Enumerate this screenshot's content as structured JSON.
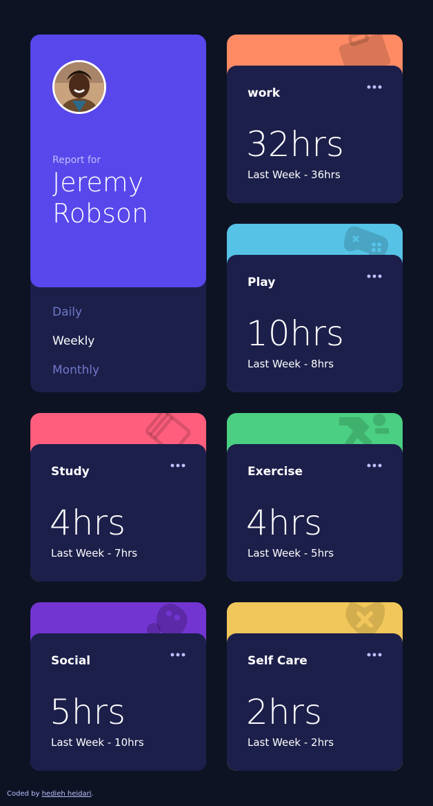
{
  "profile": {
    "report_for": "Report for",
    "first_name": "Jeremy",
    "last_name": "Robson",
    "periods": [
      "Daily",
      "Weekly",
      "Monthly"
    ],
    "active_period": "Weekly"
  },
  "cards": [
    {
      "title": "work",
      "hours": "32hrs",
      "previous": "Last Week - 36hrs",
      "color": "#ff8b64",
      "icon": "briefcase-icon"
    },
    {
      "title": "Play",
      "hours": "10hrs",
      "previous": "Last Week - 8hrs",
      "color": "#56c2e6",
      "icon": "gamepad-icon"
    },
    {
      "title": "Study",
      "hours": "4hrs",
      "previous": "Last Week - 7hrs",
      "color": "#ff5e7d",
      "icon": "books-icon"
    },
    {
      "title": "Exercise",
      "hours": "4hrs",
      "previous": "Last Week - 5hrs",
      "color": "#4bcf82",
      "icon": "runner-icon"
    },
    {
      "title": "Social",
      "hours": "5hrs",
      "previous": "Last Week - 10hrs",
      "color": "#7335d2",
      "icon": "social-icon"
    },
    {
      "title": "Self Care",
      "hours": "2hrs",
      "previous": "Last Week - 2hrs",
      "color": "#f1c75b",
      "icon": "heart-bandage-icon"
    }
  ],
  "footer": {
    "prefix": "Coded by",
    "author": "hedieh heidari",
    "suffix": "."
  }
}
